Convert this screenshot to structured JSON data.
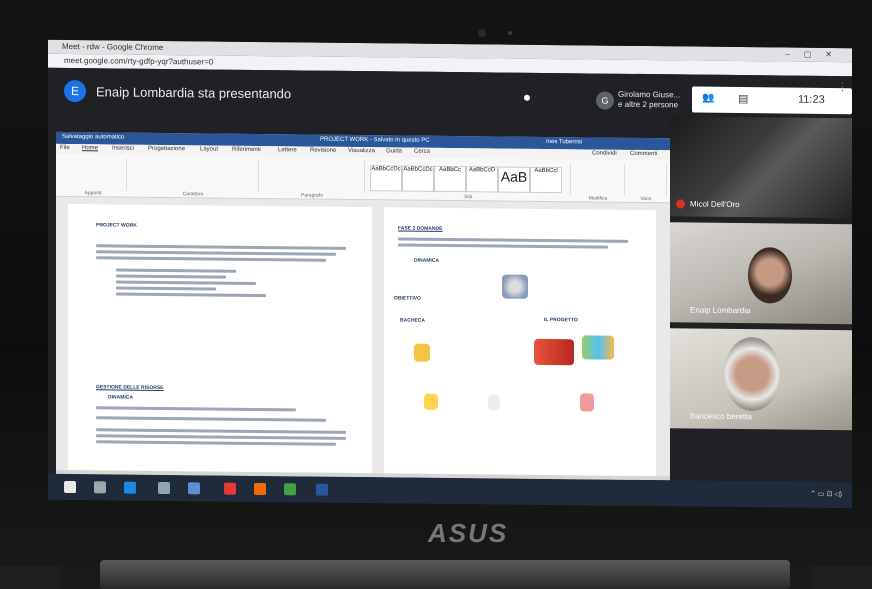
{
  "browser": {
    "tab_title": "Meet - rdw - Google Chrome",
    "url": "meet.google.com/rty-gdfp-yqr?authuser=0"
  },
  "meet": {
    "presenter_avatar": "E",
    "presenting_text": "Enaip Lombardia sta presentando",
    "participant_avatar": "G",
    "participant_name": "Girolamo Giuse...",
    "participant_sub": "e altre 2 persone",
    "clock": "11:23"
  },
  "word": {
    "autosave": "Salvataggio automatico",
    "doc_title": "PROJECT WORK - Salvato in questo PC",
    "user": "Ines Tuberosi",
    "menu": [
      "File",
      "Home",
      "Inserisci",
      "Progettazione",
      "Layout",
      "Riferimenti",
      "Lettere",
      "Revisione",
      "Visualizza",
      "Guida",
      "Cerca",
      "Condividi",
      "Commenti"
    ],
    "ribbon_groups": [
      "Appunti",
      "Carattere",
      "Paragrafo",
      "Stili",
      "Modifica",
      "Voce"
    ],
    "styles": [
      "AaBbCcDc",
      "AaBbCcDc",
      "AaBbCc",
      "AaBbCcD",
      "AaB",
      "AaBbCcl"
    ],
    "page1": {
      "heading": "PROJECT WORK",
      "section": "GESTIONE DELLE RISORSE",
      "bullet": "DINAMICA"
    },
    "page2": {
      "heading": "FASE 2 DOMANDE",
      "bullet": "DINAMICA",
      "label_obiettivo": "OBIETTIVO",
      "label_bacheca": "BACHECA",
      "label_progetto": "IL PROGETTO"
    }
  },
  "tiles": [
    {
      "name": "Micol Dell'Oro"
    },
    {
      "name": "Enaip Lombardia"
    },
    {
      "name": "francesco beretta"
    }
  ],
  "laptop": {
    "brand": "ASUS"
  },
  "colors": {
    "word_blue": "#2b579a",
    "meet_bg": "#202124",
    "presenter_blue": "#1a73e8"
  }
}
